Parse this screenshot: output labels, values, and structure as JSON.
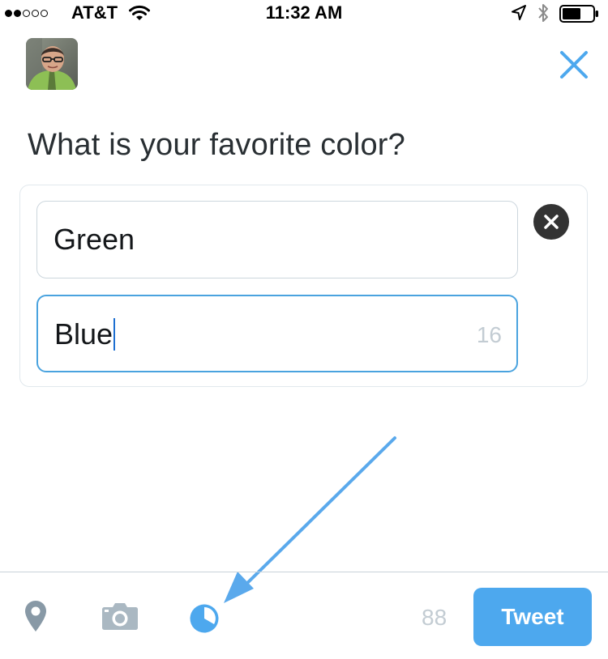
{
  "status_bar": {
    "carrier": "AT&T",
    "time": "11:32 AM",
    "signal_bars_filled": 2,
    "signal_bars_total": 5,
    "icons": [
      "wifi-icon",
      "location-arrow-icon",
      "bluetooth-icon",
      "battery-icon"
    ]
  },
  "header": {
    "avatar_icon": "user-avatar",
    "close_icon": "close-icon"
  },
  "compose": {
    "question": "What is your favorite color?"
  },
  "poll": {
    "choices": [
      {
        "value": "Green"
      },
      {
        "value": "Blue",
        "chars_remaining": "16"
      }
    ],
    "remove_icon": "remove-choice-icon"
  },
  "toolbar": {
    "icons": [
      "location-pin-icon",
      "camera-icon",
      "poll-icon"
    ],
    "char_count": "88",
    "tweet_label": "Tweet"
  },
  "colors": {
    "accent": "#4da8ee",
    "icon_gray": "#8899a6",
    "muted_text": "#c3ccd3",
    "annotation_arrow": "#5aa9ec"
  }
}
